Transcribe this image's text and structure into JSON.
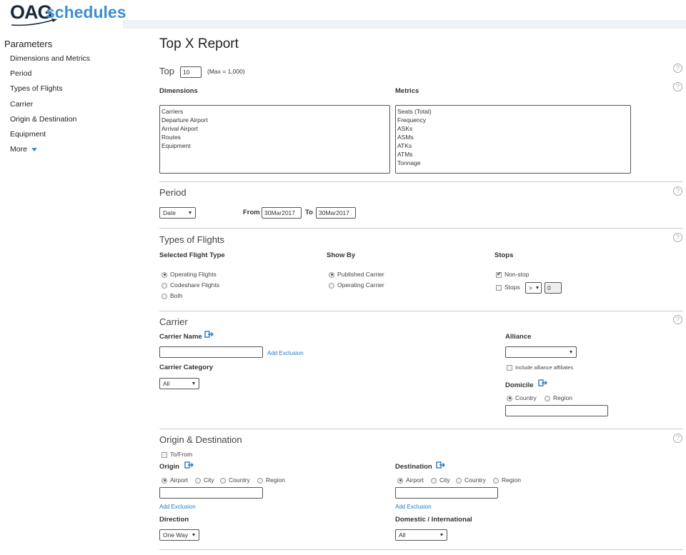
{
  "logo": {
    "oag": "OAG",
    "schedules": "schedules"
  },
  "sidebar": {
    "title": "Parameters",
    "items": [
      {
        "label": "Dimensions and Metrics"
      },
      {
        "label": "Period"
      },
      {
        "label": "Types of Flights"
      },
      {
        "label": "Carrier"
      },
      {
        "label": "Origin & Destination"
      },
      {
        "label": "Equipment"
      },
      {
        "label": "More"
      }
    ]
  },
  "report": {
    "title": "Top X Report",
    "top_label": "Top",
    "top_value": "10",
    "top_max": "(Max = 1,000)",
    "help": "?"
  },
  "dimensions": {
    "label": "Dimensions",
    "items": [
      "Carriers",
      "Departure Airport",
      "Arrival Airport",
      "Routes",
      "Equipment"
    ]
  },
  "metrics": {
    "label": "Metrics",
    "items": [
      "Seats (Total)",
      "Frequency",
      "ASKs",
      "ASMs",
      "ATKs",
      "ATMs",
      "Tonnage"
    ]
  },
  "period": {
    "title": "Period",
    "type_value": "Date",
    "from_label": "From",
    "from_value": "30Mar2017",
    "to_label": "To",
    "to_value": "30Mar2017"
  },
  "flight_types": {
    "title": "Types of Flights",
    "selected_label": "Selected Flight Type",
    "selected_options": [
      "Operating Flights",
      "Codeshare Flights",
      "Both"
    ],
    "show_by_label": "Show By",
    "show_by_options": [
      "Published Carrier",
      "Operating Carrier"
    ],
    "stops_label": "Stops",
    "nonstop": "Non-stop",
    "stops": "Stops",
    "stops_op": ">",
    "stops_value": "0"
  },
  "carrier": {
    "title": "Carrier",
    "name_label": "Carrier Name",
    "add_exclusion": "Add Exclusion",
    "category_label": "Carrier Category",
    "category_value": "All",
    "alliance_label": "Alliance",
    "alliance_value": "",
    "include_affiliates": "Include alliance affiliates",
    "domicile_label": "Domicile",
    "domicile_options": [
      "Country",
      "Region"
    ]
  },
  "od": {
    "title": "Origin & Destination",
    "to_from": "To/From",
    "origin_label": "Origin",
    "destination_label": "Destination",
    "loc_options": [
      "Airport",
      "City",
      "Country",
      "Region"
    ],
    "add_exclusion": "Add Exclusion",
    "direction_label": "Direction",
    "direction_value": "One Way",
    "domint_label": "Domestic / International",
    "domint_value": "All"
  }
}
